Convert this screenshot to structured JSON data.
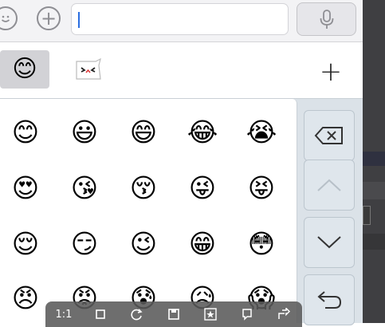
{
  "input_bar": {
    "text_value": "",
    "smiley_icon": "smiley-face-icon",
    "plus_icon": "plus-circle-icon",
    "plus_glyph": "+",
    "mic_icon": "microphone-icon"
  },
  "categories": {
    "active_emoji": "😊",
    "active_icon": "recent-emoji-tab-icon",
    "sticker_icon": "sticker-tab-icon",
    "add_glyph": "+"
  },
  "emoji_rows": [
    [
      "😊",
      "😃",
      "😄",
      "😂",
      "😭"
    ],
    [
      "😍",
      "😘",
      "😚",
      "😜",
      "😝"
    ],
    [
      "😌",
      "😏",
      "😉",
      "😁",
      "😳"
    ],
    [
      "😠",
      "😡",
      "😰",
      "😥",
      "😱"
    ]
  ],
  "side_keys": [
    {
      "name": "backspace-key",
      "icon": "backspace-icon"
    },
    {
      "name": "page-up-key",
      "icon": "chevron-up-icon"
    },
    {
      "name": "page-down-key",
      "icon": "chevron-down-icon"
    },
    {
      "name": "return-key",
      "icon": "return-arrow-icon"
    }
  ],
  "floating_toolbar": {
    "items": [
      "1:1",
      "crop-icon",
      "rotate-icon",
      "save-icon",
      "favorite-icon",
      "copy-icon",
      "share-icon"
    ],
    "ratio_label": "1:1"
  },
  "colors": {
    "bar_bg": "#f3f3f5",
    "grid_bg": "#ffffff",
    "side_panel_bg": "#dbe2e8",
    "caret": "#2b6ee0"
  }
}
